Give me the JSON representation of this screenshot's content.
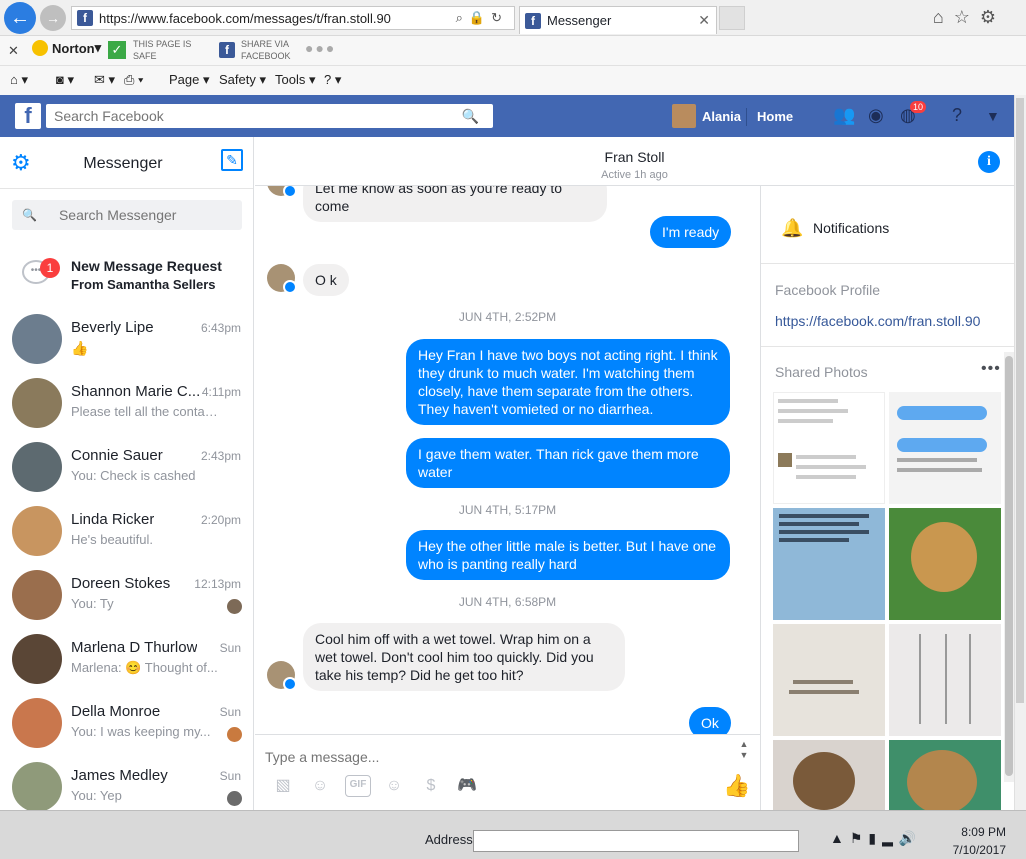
{
  "browser": {
    "url": "https://www.facebook.com/messages/t/fran.stoll.90",
    "tab_title": "Messenger",
    "norton_label": "Norton",
    "safe_line1": "THIS PAGE IS",
    "safe_line2": "SAFE",
    "share_line1": "SHARE VIA",
    "share_line2": "FACEBOOK",
    "menu": [
      "Page",
      "Safety",
      "Tools"
    ]
  },
  "fb_bar": {
    "search_placeholder": "Search Facebook",
    "user_name": "Alania",
    "home_label": "Home",
    "notif_count": "10"
  },
  "sidebar": {
    "title": "Messenger",
    "search_placeholder": "Search Messenger",
    "request": {
      "title": "New Message Request",
      "from": "From Samantha Sellers",
      "badge": "1"
    },
    "conversations": [
      {
        "name": "Beverly Lipe",
        "time": "6:43pm",
        "snippet": "",
        "avatar_color": "#6c7d8e"
      },
      {
        "name": "Shannon Marie C...",
        "time": "4:11pm",
        "snippet": "Please tell all the contac...",
        "avatar_color": "#8a7a5c"
      },
      {
        "name": "Connie Sauer",
        "time": "2:43pm",
        "snippet": "You: Check is cashed",
        "avatar_color": "#5d6a70"
      },
      {
        "name": "Linda Ricker",
        "time": "2:20pm",
        "snippet": "He's beautiful.",
        "avatar_color": "#c89560"
      },
      {
        "name": "Doreen Stokes",
        "time": "12:13pm",
        "snippet": "You: Ty",
        "avatar_color": "#9a6e4d"
      },
      {
        "name": "Marlena D Thurlow",
        "time": "Sun",
        "snippet": "Marlena: 😊 Thought of...",
        "avatar_color": "#5a4636"
      },
      {
        "name": "Della Monroe",
        "time": "Sun",
        "snippet": "You: I was keeping my...",
        "avatar_color": "#c9774d"
      },
      {
        "name": "James Medley",
        "time": "Sun",
        "snippet": "You: Yep",
        "avatar_color": "#8f9a7a"
      }
    ]
  },
  "chat": {
    "contact_name": "Fran Stoll",
    "status": "Active 1h ago",
    "partial_top": "Let me know as soon as you're ready to come",
    "messages": {
      "m1": "I'm ready",
      "m2": "O k",
      "stamp1": "JUN 4TH, 2:52PM",
      "m3": "Hey Fran I have two boys not acting right. I think they drunk to much water.  I'm watching them closely, have them separate from the others. They haven't vomieted or no diarrhea.",
      "m4": "I gave them water. Than rick gave them more water",
      "stamp2": "JUN 4TH, 5:17PM",
      "m5": "Hey the other little male is better. But I have one who is panting really hard",
      "stamp3": "JUN 4TH, 6:58PM",
      "m6": "Cool him off with a wet towel.  Wrap him on a wet towel.   Don't cool him too quickly.  Did you take his temp?  Did he get too hit?",
      "m7": "Ok"
    },
    "compose_placeholder": "Type a message..."
  },
  "details": {
    "notifications_label": "Notifications",
    "profile_label": "Facebook Profile",
    "profile_link": "https://facebook.com/fran.stoll.90",
    "photos_label": "Shared Photos"
  },
  "taskbar": {
    "address_label": "Address",
    "time": "8:09 PM",
    "date": "7/10/2017"
  },
  "colors": {
    "fb_blue": "#4267b2",
    "messenger_blue": "#0084ff"
  }
}
